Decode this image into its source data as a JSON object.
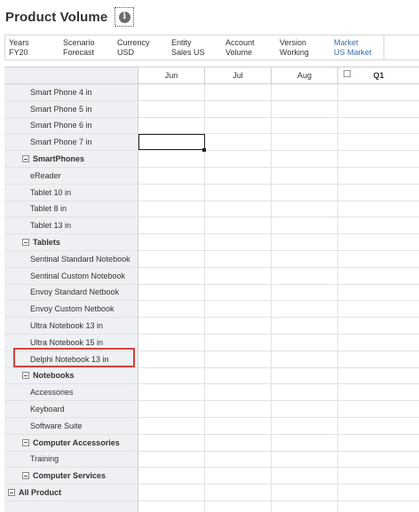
{
  "header": {
    "title": "Product Volume",
    "info_icon": "info-icon"
  },
  "pov": [
    {
      "dimension": "Years",
      "member": "FY20"
    },
    {
      "dimension": "Scenario",
      "member": "Forecast"
    },
    {
      "dimension": "Currency",
      "member": "USD"
    },
    {
      "dimension": "Entity",
      "member": "Sales US"
    },
    {
      "dimension": "Account",
      "member": "Volume"
    },
    {
      "dimension": "Version",
      "member": "Working"
    },
    {
      "dimension": "Market",
      "member": "US Market"
    }
  ],
  "columns": [
    "Jun",
    "Jul",
    "Aug",
    "Q1"
  ],
  "rows": [
    {
      "label": "Smart Phone 4 in",
      "kind": "child"
    },
    {
      "label": "Smart Phone 5 in",
      "kind": "child"
    },
    {
      "label": "Smart Phone 6 in",
      "kind": "child"
    },
    {
      "label": "Smart Phone 7 in",
      "kind": "child"
    },
    {
      "label": "SmartPhones",
      "kind": "parent"
    },
    {
      "label": "eReader",
      "kind": "child"
    },
    {
      "label": "Tablet 10 in",
      "kind": "child"
    },
    {
      "label": "Tablet 8 in",
      "kind": "child"
    },
    {
      "label": "Tablet 13 in",
      "kind": "child"
    },
    {
      "label": "Tablets",
      "kind": "parent"
    },
    {
      "label": "Sentinal Standard Notebook",
      "kind": "child"
    },
    {
      "label": "Sentinal Custom Notebook",
      "kind": "child"
    },
    {
      "label": "Envoy Standard Netbook",
      "kind": "child"
    },
    {
      "label": "Envoy Custom Netbook",
      "kind": "child"
    },
    {
      "label": "Ultra Notebook 13 in",
      "kind": "child"
    },
    {
      "label": "Ultra Notebook 15 in",
      "kind": "child"
    },
    {
      "label": "Delphi Notebook 13 in",
      "kind": "child",
      "highlighted": true
    },
    {
      "label": "Notebooks",
      "kind": "parent"
    },
    {
      "label": "Accessories",
      "kind": "child"
    },
    {
      "label": "Keyboard",
      "kind": "child"
    },
    {
      "label": "Software Suite",
      "kind": "child"
    },
    {
      "label": "Computer Accessories",
      "kind": "parent"
    },
    {
      "label": "Training",
      "kind": "child"
    },
    {
      "label": "Computer Services",
      "kind": "parent"
    },
    {
      "label": "All Product",
      "kind": "top"
    },
    {
      "label": "",
      "kind": "child"
    }
  ],
  "selected_cell": {
    "row": 3,
    "col": 0
  },
  "colors": {
    "highlight": "#d0453a",
    "market_link": "#3a6fa5",
    "row_header_bg": "#eef0f3"
  }
}
